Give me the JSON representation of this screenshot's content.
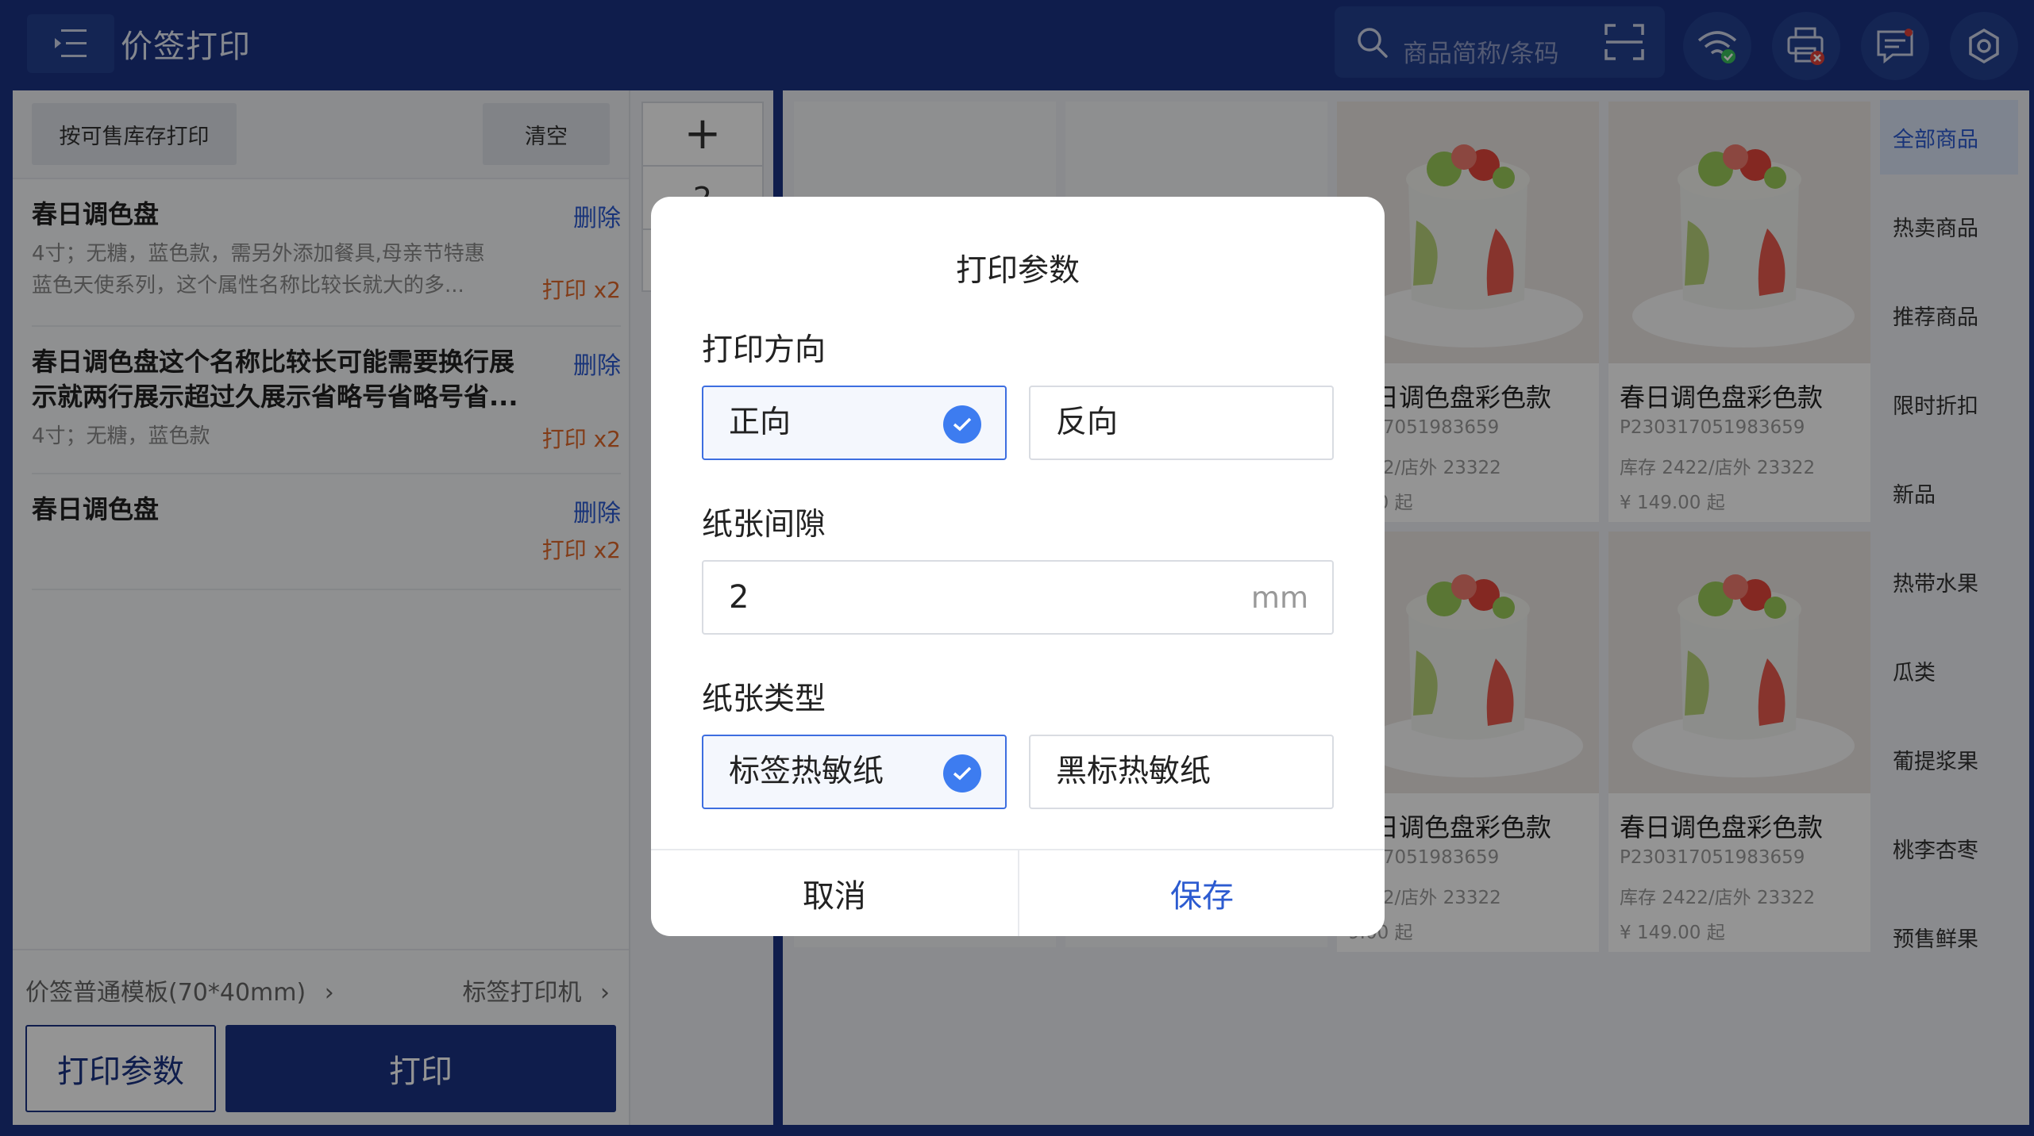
{
  "header": {
    "title": "价签打印",
    "search_placeholder": "商品简称/条码"
  },
  "left": {
    "stock_print_label": "按可售库存打印",
    "clear_label": "清空",
    "items": [
      {
        "name": "春日调色盘",
        "desc1": "4寸；无糖，蓝色款，需另外添加餐具,母亲节特惠",
        "desc2": "蓝色天使系列，这个属性名称比较长就大的多...",
        "delete": "删除",
        "count": "打印 x2"
      },
      {
        "name1": "春日调色盘这个名称比较长可能需要换行展",
        "name2": "示就两行展示超过久展示省略号省略号省...",
        "desc1": "4寸；无糖，蓝色款",
        "delete": "删除",
        "count": "打印 x2"
      },
      {
        "name": "春日调色盘",
        "delete": "删除",
        "count": "打印 x2"
      }
    ],
    "template": "价签普通模板(70*40mm)",
    "printer": "标签打印机",
    "param_button": "打印参数",
    "print_button": "打印"
  },
  "qty": {
    "plus": "+",
    "value": "2"
  },
  "products": [
    {
      "name": "春日调色盘彩色款",
      "code": "0317051983659",
      "stock": "2422/店外 23322",
      "price": "9.00 起"
    },
    {
      "name": "春日调色盘彩色款",
      "code": "P230317051983659",
      "stock": "库存 2422/店外 23322",
      "price": "¥ 149.00 起"
    },
    {
      "name": "春日调色盘彩色款",
      "code": "0317051983659",
      "stock": "2422/店外 23322",
      "price": "9.00 起"
    },
    {
      "name": "春日调色盘彩色款",
      "code": "P230317051983659",
      "stock": "库存 2422/店外 23322",
      "price": "¥ 149.00 起"
    }
  ],
  "categories": [
    "全部商品",
    "热卖商品",
    "推荐商品",
    "限时折扣",
    "新品",
    "热带水果",
    "瓜类",
    "葡提浆果",
    "桃李杏枣",
    "预售鲜果"
  ],
  "modal": {
    "title": "打印参数",
    "direction_label": "打印方向",
    "direction_options": [
      "正向",
      "反向"
    ],
    "direction_selected": "正向",
    "gap_label": "纸张间隙",
    "gap_value": "2",
    "gap_unit": "mm",
    "paper_label": "纸张类型",
    "paper_options": [
      "标签热敏纸",
      "黑标热敏纸"
    ],
    "paper_selected": "标签热敏纸",
    "cancel": "取消",
    "save": "保存"
  },
  "colors": {
    "primary": "#1a3384",
    "accent": "#3d7cf0",
    "link": "#2c5bd0",
    "warn": "#e0682a"
  }
}
